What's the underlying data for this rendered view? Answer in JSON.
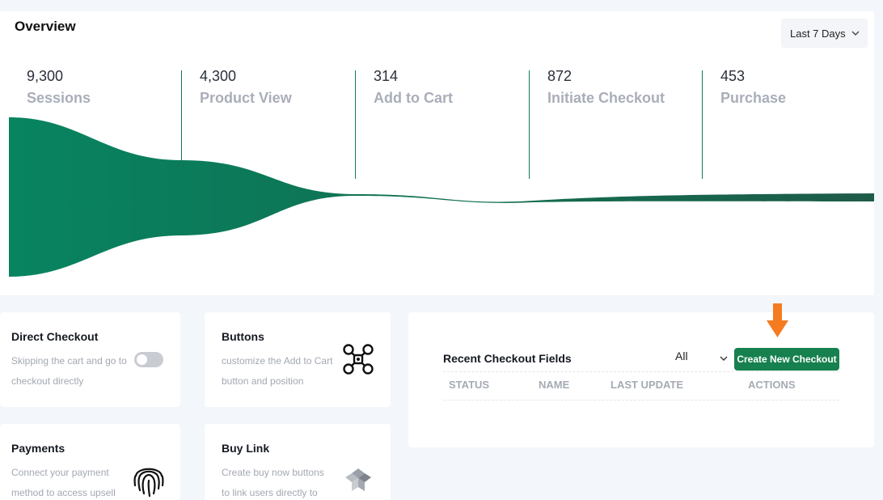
{
  "overview": {
    "title": "Overview",
    "range": {
      "selected": "Last 7 Days"
    },
    "funnel_color": "#0a7d5f",
    "stages": [
      {
        "value": "9,300",
        "label": "Sessions"
      },
      {
        "value": "4,300",
        "label": "Product View"
      },
      {
        "value": "314",
        "label": "Add to Cart"
      },
      {
        "value": "872",
        "label": "Initiate Checkout"
      },
      {
        "value": "453",
        "label": "Purchase"
      }
    ]
  },
  "cards": [
    {
      "title": "Direct Checkout",
      "desc": [
        "Skipping the cart and go to",
        "checkout directly"
      ],
      "control": "toggle",
      "toggle_on": false
    },
    {
      "title": "Buttons",
      "desc": [
        "customize the Add to Cart",
        "button and position"
      ],
      "icon": "drone-icon"
    },
    {
      "title": "Payments",
      "desc": [
        "Connect your payment",
        "method to access upsell"
      ],
      "icon": "fingerprint-icon"
    },
    {
      "title": "Buy Link",
      "desc": [
        "Create buy now buttons",
        "to link users directly to"
      ],
      "icon": "cube-stack-icon"
    }
  ],
  "recent": {
    "title": "Recent Checkout Fields",
    "filter": {
      "selected": "All"
    },
    "create_label": "Create New Checkout",
    "columns": [
      "STATUS",
      "NAME",
      "LAST UPDATE",
      "ACTIONS"
    ]
  },
  "colors": {
    "primary": "#17804f",
    "accent_arrow": "#f47b20",
    "muted_text": "#a9aeb9"
  }
}
